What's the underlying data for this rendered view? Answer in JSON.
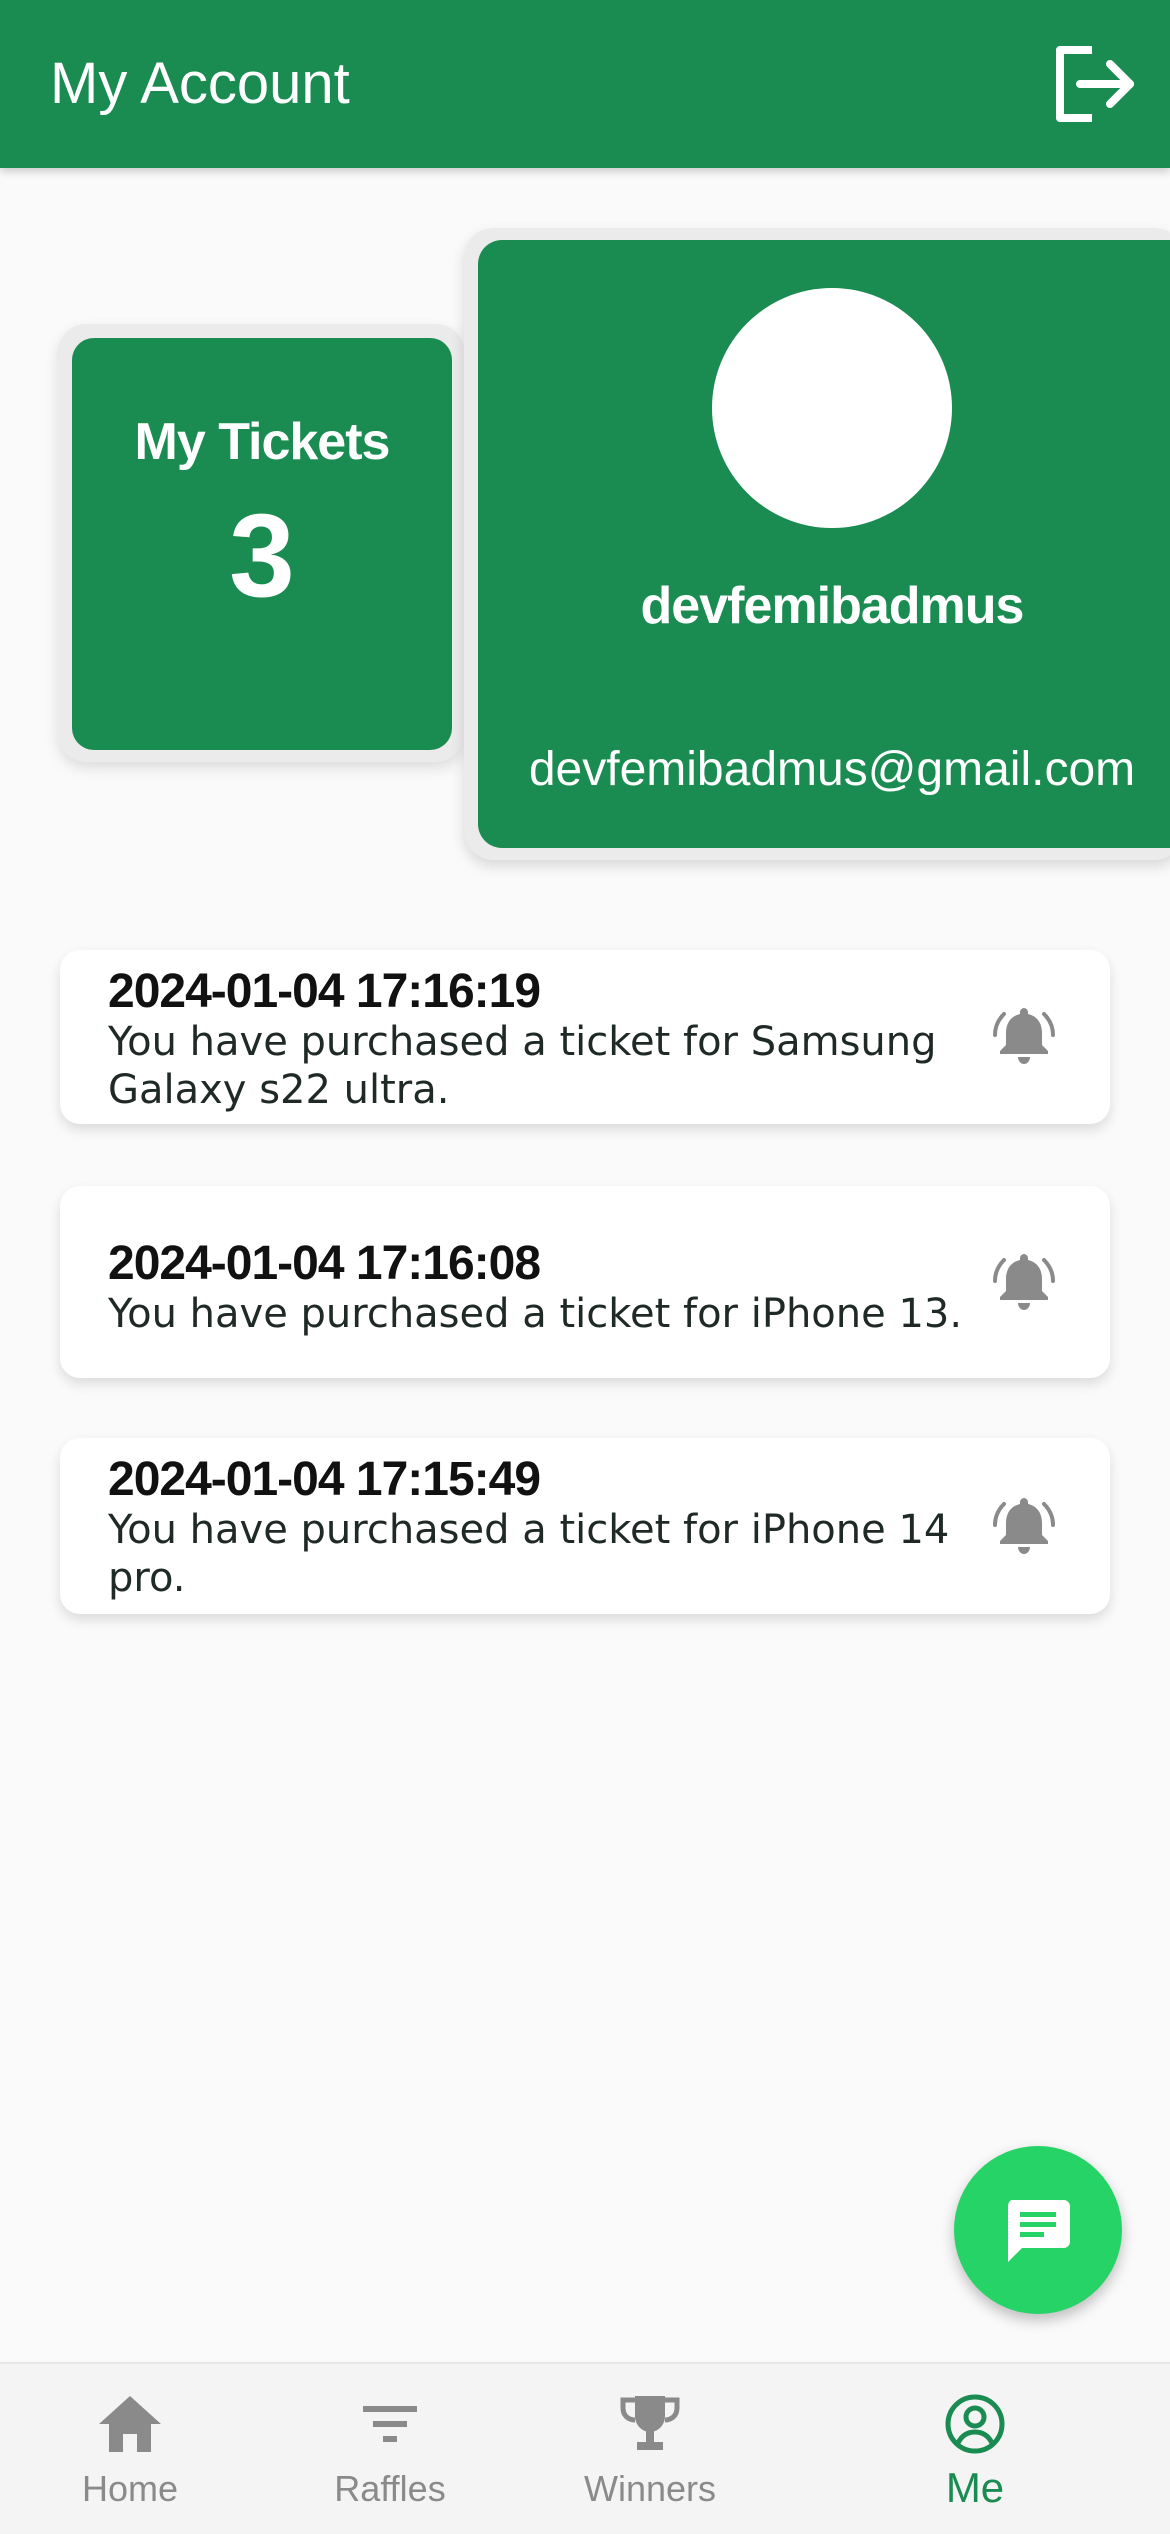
{
  "header": {
    "title": "My Account",
    "logout_icon": "logout-icon"
  },
  "tickets": {
    "label": "My Tickets",
    "count": "3"
  },
  "profile": {
    "username": "devfemibadmus",
    "email": "devfemibadmus@gmail.com"
  },
  "notifications": [
    {
      "time": "2024-01-04 17:16:19",
      "message": "You have purchased a ticket for Samsung Galaxy s22 ultra."
    },
    {
      "time": "2024-01-04 17:16:08",
      "message": "You have purchased a ticket for iPhone 13."
    },
    {
      "time": "2024-01-04 17:15:49",
      "message": "You have purchased a ticket for iPhone 14 pro."
    }
  ],
  "fab": {
    "icon": "chat-icon"
  },
  "nav": {
    "items": [
      {
        "label": "Home",
        "icon": "home-icon"
      },
      {
        "label": "Raffles",
        "icon": "filter-icon"
      },
      {
        "label": "Winners",
        "icon": "trophy-icon"
      },
      {
        "label": "Me",
        "icon": "account-circle-icon",
        "active": true
      }
    ]
  },
  "colors": {
    "primary": "#1a8c51",
    "fab": "#25d366",
    "nav_inactive": "#8a8a8a",
    "background": "#fafafa"
  }
}
